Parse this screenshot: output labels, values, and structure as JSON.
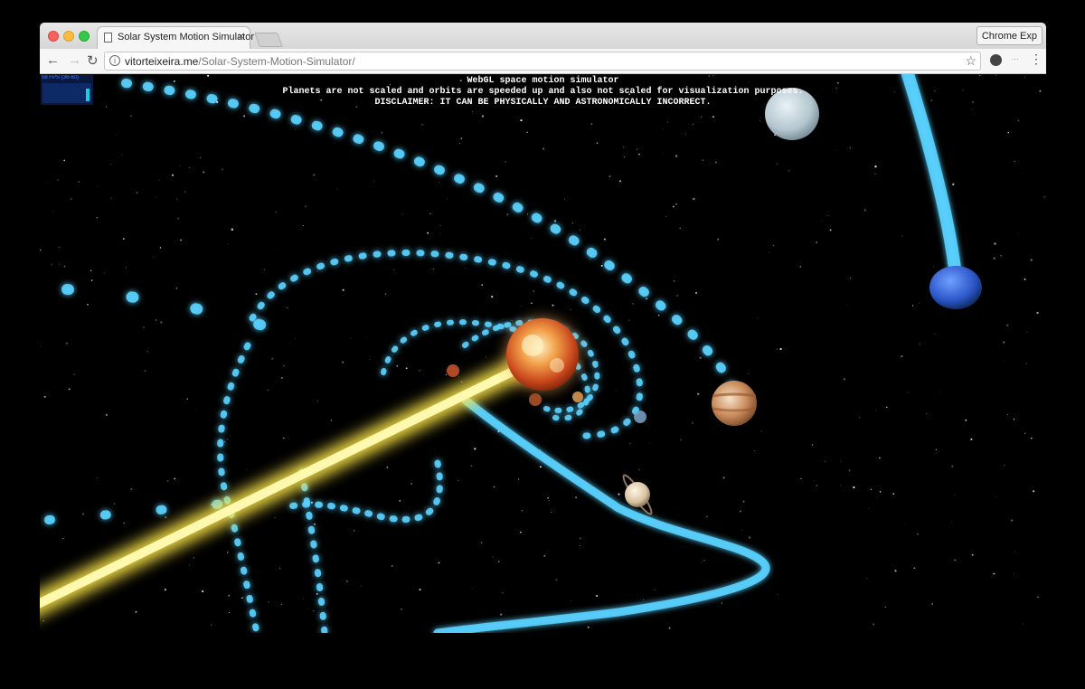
{
  "browser": {
    "tab_title": "Solar System Motion Simulator",
    "tab_close": "×",
    "extension_button": "Chrome Exp",
    "url_host": "vitorteixeira.me",
    "url_path": "/Solar-System-Motion-Simulator/",
    "icons": {
      "back": "arrow-left-icon",
      "forward": "arrow-right-icon",
      "reload": "reload-icon",
      "info": "info-icon",
      "star": "star-icon",
      "menu": "kebab-menu-icon",
      "page": "page-icon"
    }
  },
  "app": {
    "heading_line1": "WebGL space motion simulator",
    "heading_line2": "Planets are not scaled and orbits are speeded up and also not scaled for visualization purposes.",
    "heading_line3": "DISCLAIMER: IT CAN BE PHYSICALLY AND ASTRONOMICALLY INCORRECT.",
    "stats_label": "58 FPS (36-60)"
  },
  "colors": {
    "orbit_trail": "#5ad2ff",
    "sun_trail": "#fff36a",
    "space": "#000000"
  }
}
